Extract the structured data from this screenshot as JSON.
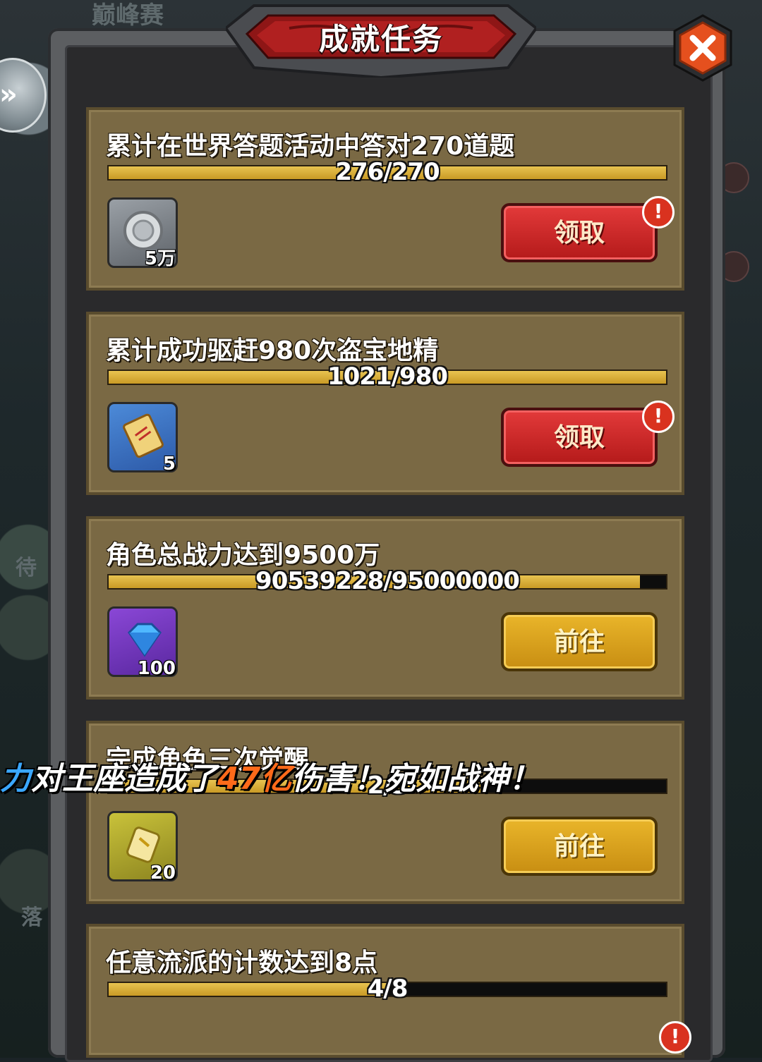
{
  "background": {
    "top_label": "巅峰赛",
    "side_label_1": "待",
    "side_label_2": "落"
  },
  "header": {
    "title": "成就任务"
  },
  "tasks": [
    {
      "title": "累计在世界答题活动中答对270道题",
      "progress_text": "276/270",
      "progress": 1.0,
      "reward_icon": "silver-coin-icon",
      "reward_count": "5万",
      "button_label": "领取",
      "button_type": "claim",
      "has_alert": true
    },
    {
      "title": "累计成功驱赶980次盗宝地精",
      "progress_text": "1021/980",
      "progress": 1.0,
      "reward_icon": "scroll-icon",
      "reward_count": "5",
      "button_label": "领取",
      "button_type": "claim",
      "has_alert": true
    },
    {
      "title": "角色总战力达到9500万",
      "progress_text": "90539228/95000000",
      "progress": 0.953,
      "reward_icon": "diamond-icon",
      "reward_count": "100",
      "button_label": "前往",
      "button_type": "goto",
      "has_alert": false
    },
    {
      "title": "完成角色三次觉醒",
      "progress_text": "2/3",
      "progress": 0.667,
      "reward_icon": "gold-scroll-icon",
      "reward_count": "20",
      "button_label": "前往",
      "button_type": "goto",
      "has_alert": false
    },
    {
      "title": "任意流派的计数达到8点",
      "progress_text": "4/8",
      "progress": 0.5
    }
  ],
  "alert_glyph": "!",
  "close_glyph": "✕",
  "side_button_glyph": "»",
  "broadcast": {
    "part1": "力",
    "part2": "对王座造成了",
    "part3": "47亿",
    "part4": "伤害！宛如战神！"
  },
  "colors": {
    "claim_button": "#c62424",
    "goto_button": "#d9a11f",
    "progress_fill": "#d9ae3a",
    "card_bg": "#7a6944",
    "broadcast_name": "#3aa7ff",
    "broadcast_number": "#ff6a1a"
  }
}
